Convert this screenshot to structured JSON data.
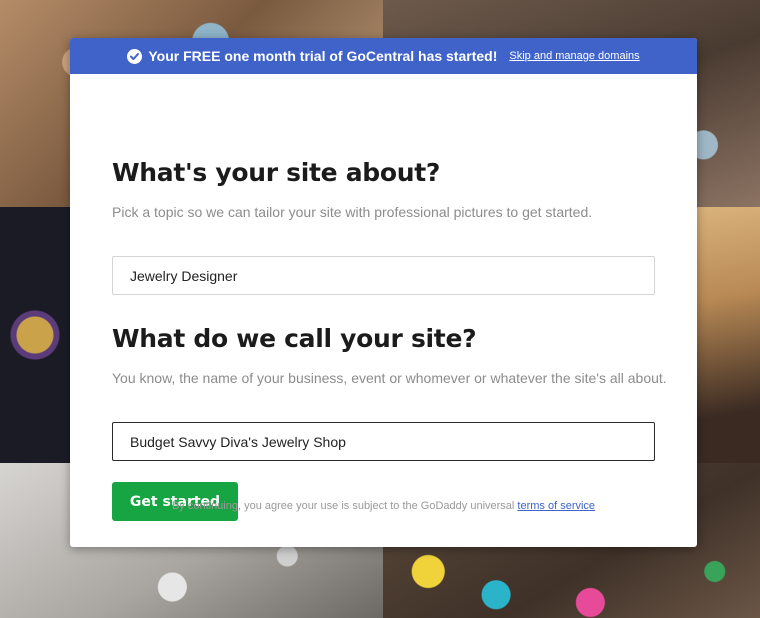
{
  "banner": {
    "icon": "check-circle-icon",
    "message": "Your FREE one month trial of GoCentral has started!",
    "link_label": "Skip and manage domains",
    "color": "#3f63c8"
  },
  "topic": {
    "heading": "What's your site about?",
    "description": "Pick a topic so we can tailor your site with professional pictures to get started.",
    "value": "Jewelry Designer"
  },
  "site_name": {
    "heading": "What do we call your site?",
    "description": "You know, the name of your business, event or whomever or whatever the site's all about.",
    "value": "Budget Savvy Diva's Jewelry Shop"
  },
  "cta": {
    "label": "Get started",
    "color": "#16a542"
  },
  "legal": {
    "text": "By continuing, you agree your use is subject to the GoDaddy universal",
    "link_label": "terms of service"
  }
}
